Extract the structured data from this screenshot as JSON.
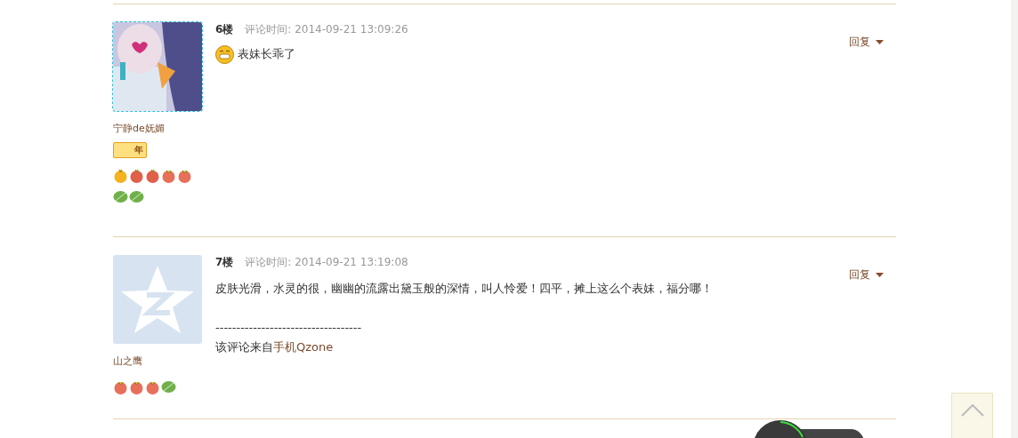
{
  "comments": [
    {
      "floor": "6楼",
      "time": "评论时间: 2014-09-21 13:09:26",
      "reply": "回复",
      "avatar": {
        "kind": "picture"
      },
      "name": "宁静de妩媚",
      "year_badge": {
        "label": "年"
      },
      "badge_rows": [
        [
          {
            "kind": "orange"
          },
          {
            "kind": "tomato"
          },
          {
            "kind": "tomato"
          },
          {
            "kind": "peach"
          },
          {
            "kind": "peach"
          }
        ],
        [
          {
            "kind": "leaf"
          },
          {
            "kind": "leaf"
          }
        ]
      ],
      "body": [
        {
          "kind": "emoji",
          "text": "表妹长乖了"
        }
      ]
    },
    {
      "floor": "7楼",
      "time": "评论时间: 2014-09-21 13:19:08",
      "reply": "回复",
      "avatar": {
        "kind": "default"
      },
      "name": "山之鹰",
      "badge_rows": [
        [
          {
            "kind": "peach"
          },
          {
            "kind": "peach"
          },
          {
            "kind": "peach"
          },
          {
            "kind": "leaf"
          }
        ]
      ],
      "body": [
        {
          "kind": "text",
          "text": "皮肤光滑，水灵的很，幽幽的流露出黛玉般的深情，叫人怜爱！四平，摊上这么个表妹，福分哪！"
        },
        {
          "kind": "blank"
        },
        {
          "kind": "text",
          "text": "-----------------------------------"
        },
        {
          "kind": "source",
          "prefix": "该评论来自",
          "link": "手机Qzone"
        }
      ]
    }
  ]
}
